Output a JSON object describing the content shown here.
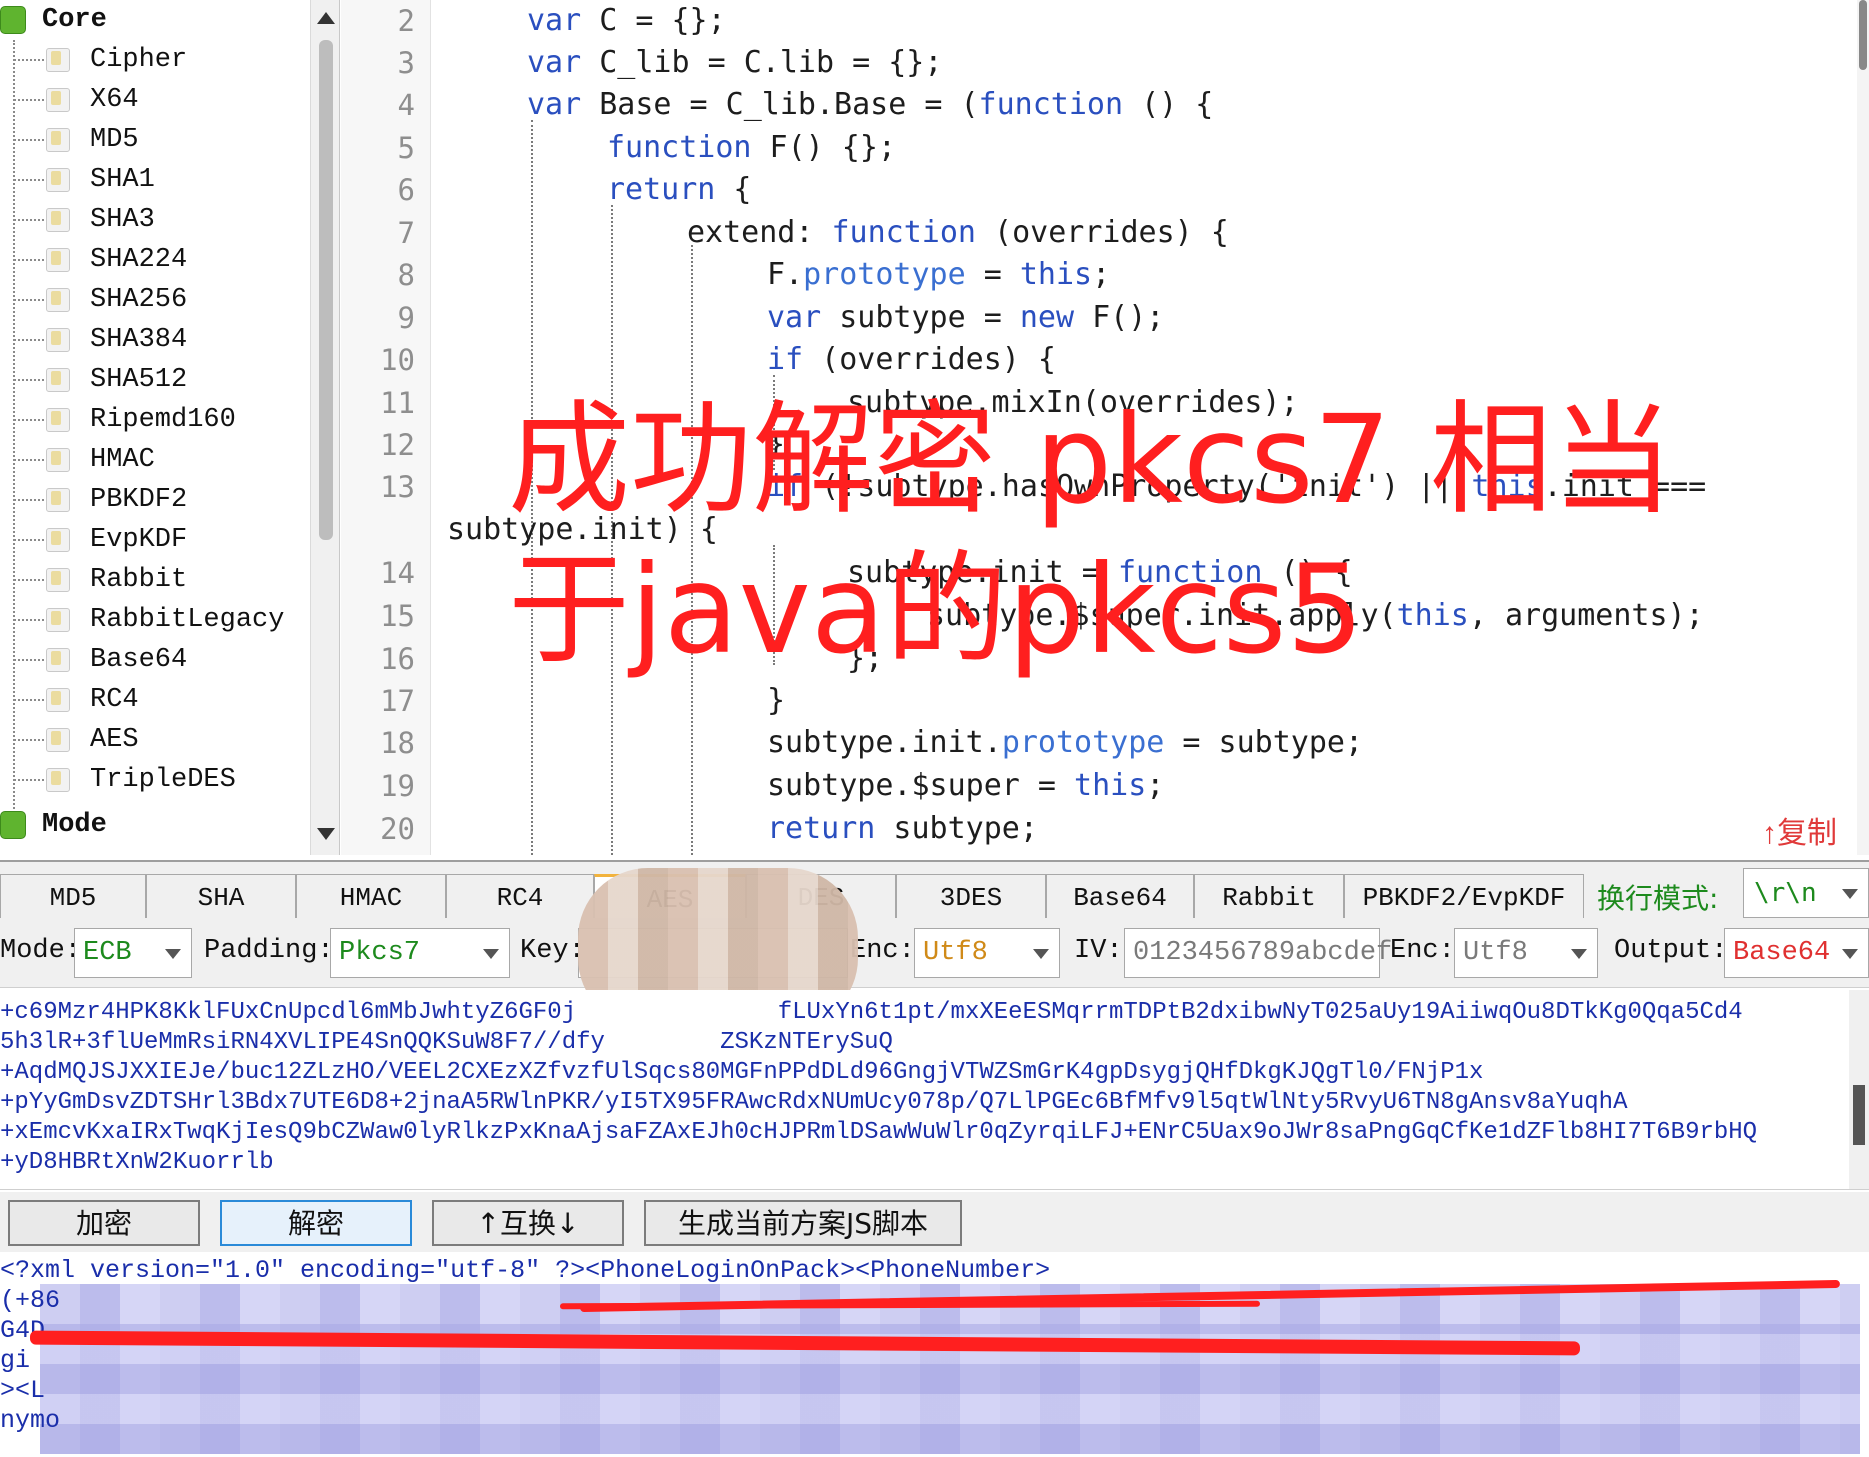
{
  "tree": {
    "root_core": "Core",
    "items": [
      "Cipher",
      "X64",
      "MD5",
      "SHA1",
      "SHA3",
      "SHA224",
      "SHA256",
      "SHA384",
      "SHA512",
      "Ripemd160",
      "HMAC",
      "PBKDF2",
      "EvpKDF",
      "Rabbit",
      "RabbitLegacy",
      "Base64",
      "RC4",
      "AES",
      "TripleDES"
    ],
    "root_mode": "Mode"
  },
  "editor": {
    "line_numbers": [
      "2",
      "3",
      "4",
      "5",
      "6",
      "7",
      "8",
      "9",
      "10",
      "11",
      "12",
      "13",
      "14",
      "15",
      "16",
      "17",
      "18",
      "19",
      "20"
    ],
    "copy_label": "↑复制"
  },
  "overlay": {
    "line1": "成功解密 pkcs7 相当",
    "line2": "于java的pkcs5"
  },
  "tabs": {
    "items": [
      "MD5",
      "SHA",
      "HMAC",
      "RC4",
      "AES",
      "DES",
      "3DES",
      "Base64",
      "Rabbit",
      "PBKDF2/EvpKDF"
    ],
    "wrap_label": "换行模式:",
    "wrap_value": "\\r\\n"
  },
  "options": {
    "mode_label": "Mode:",
    "mode_value": "ECB",
    "padding_label": "Padding:",
    "padding_value": "Pkcs7",
    "key_label": "Key:",
    "enc1_label": "Enc:",
    "enc1_value": "Utf8",
    "iv_label": "IV:",
    "iv_value": "0123456789abcdef",
    "enc2_label": "Enc:",
    "enc2_value": "Utf8",
    "output_label": "Output:",
    "output_value": "Base64"
  },
  "cipher_lines": [
    "+c69Mzr4HPK8KklFUxCnUpcdl6mMbJwhtyZ6GF0j              fLUxYn6t1pt/mxXEeESMqrrmTDPtB2dxibwNyT025aUy19AiiwqOu8DTkKg0Qqa5Cd4",
    "5h3lR+3flUeMmRsiRN4XVLIPE4SnQQKSuW8F7//dfy        ZSKzNTErySuQ",
    "+AqdMQJSJXXIEJe/buc12ZLzHO/VEEL2CXEzXZfvzfUlSqcs80MGFnPPdDLd96GngjVTWZSmGrK4gpDsygjQHfDkgKJQgTl0/FNjP1x",
    "+pYyGmDsvZDTSHrl3Bdx7UTE6D8+2jnaA5RWlnPKR/yI5TX95FRAwcRdxNUmUcy078p/Q7LlPGEc6BfMfv9l5qtWlNty5RvyU6TN8gAnsv8aYuqhA",
    "+xEmcvKxaIRxTwqKjIesQ9bCZWaw0lyRlkzPxKnaAjsaFZAxEJh0cHJPRmlDSawWuWlr0qZyrqiLFJ+ENrC5Uax9oJWr8saPngGqCfKe1dZFlb8HI7T6B9rbHQ",
    "+yD8HBRtXnW2Kuorrlb"
  ],
  "buttons": {
    "encrypt": "加密",
    "decrypt": "解密",
    "swap": "↑互换↓",
    "gen_script": "生成当前方案JS脚本"
  },
  "plain_lines": [
    "<?xml version=\"1.0\" encoding=\"utf-8\" ?><PhoneLoginOnPack><PhoneNumber>",
    "(+86",
    "G4D",
    "gi",
    "><L",
    "nymo"
  ],
  "colors": {
    "keyword": "#2a4fbf",
    "overlay_red": "#ff1f1f",
    "cipher_text": "#1a2eaa",
    "option_green": "#1d8a1d"
  }
}
